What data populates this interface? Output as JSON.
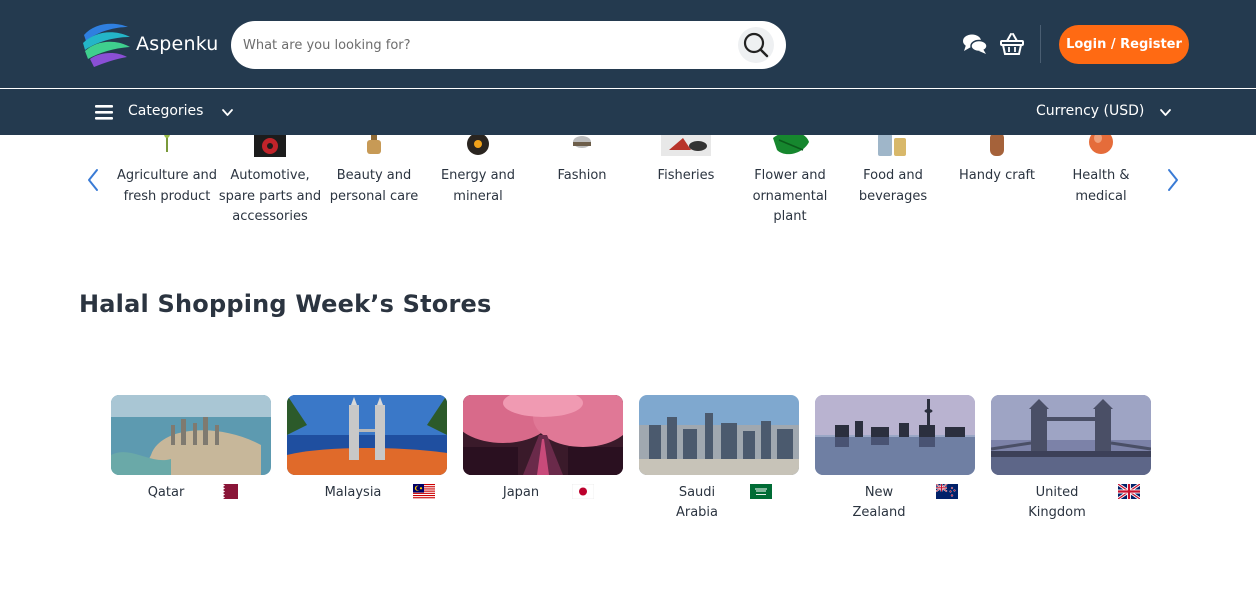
{
  "header": {
    "logo_text": "Aspenku",
    "search_placeholder": "What are you looking for?",
    "login_label": "Login / Register",
    "colors": {
      "bar": "#243a4f",
      "accent": "#ff6a13"
    },
    "icons": [
      "search-icon",
      "chat-icon",
      "basket-icon"
    ]
  },
  "category_bar": {
    "categories_label": "Categories",
    "currency_label": "Currency (USD)",
    "icons": [
      "menu-icon",
      "chevron-down-icon"
    ]
  },
  "categories": [
    {
      "name": "Agriculture and fresh product"
    },
    {
      "name": "Automotive, spare parts and accessories"
    },
    {
      "name": "Beauty and personal care"
    },
    {
      "name": "Energy and mineral"
    },
    {
      "name": "Fashion"
    },
    {
      "name": "Fisheries"
    },
    {
      "name": "Flower and ornamental plant"
    },
    {
      "name": "Food and beverages"
    },
    {
      "name": "Handy craft"
    },
    {
      "name": "Health & medical"
    }
  ],
  "stores_section": {
    "title": "Halal Shopping Week’s Stores",
    "stores": [
      {
        "name": "Qatar",
        "flag": "qatar-flag"
      },
      {
        "name": "Malaysia",
        "flag": "malaysia-flag"
      },
      {
        "name": "Japan",
        "flag": "japan-flag"
      },
      {
        "name": "Saudi Arabia",
        "flag": "saudi-arabia-flag"
      },
      {
        "name": "New Zealand",
        "flag": "new-zealand-flag"
      },
      {
        "name": "United Kingdom",
        "flag": "united-kingdom-flag"
      }
    ]
  }
}
